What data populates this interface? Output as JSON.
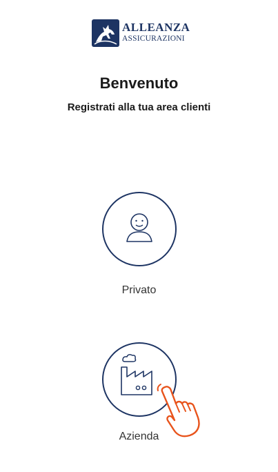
{
  "brand": {
    "name_line1": "ALLEANZA",
    "name_line2": "ASSICURAZIONI",
    "logo_icon": "horse-rider-logo-icon",
    "color": "#1d3463"
  },
  "header": {
    "title": "Benvenuto",
    "subtitle": "Registrati alla tua area clienti"
  },
  "options": [
    {
      "label": "Privato",
      "icon": "person-icon"
    },
    {
      "label": "Azienda",
      "icon": "factory-icon"
    }
  ],
  "pointer": {
    "icon": "hand-pointer-icon",
    "color": "#e8531b"
  }
}
